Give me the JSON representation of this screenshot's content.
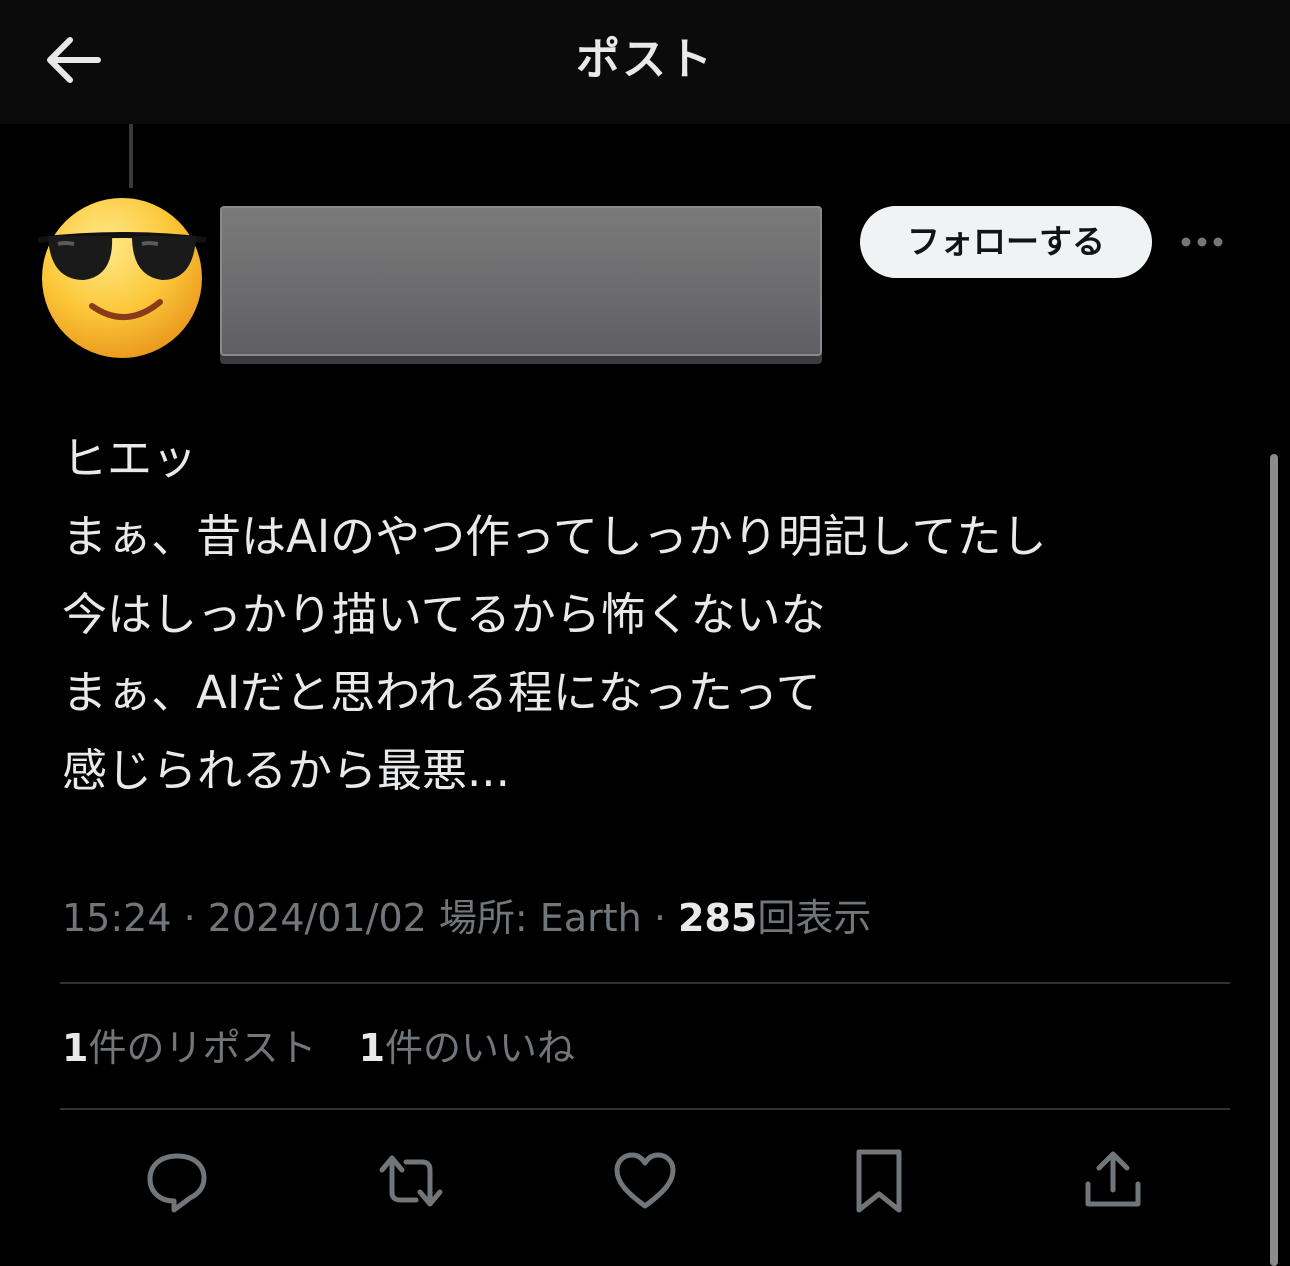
{
  "header": {
    "title": "ポスト",
    "back_icon": "arrow-left-icon"
  },
  "author": {
    "avatar_icon": "smiling-face-with-sunglasses-emoji",
    "follow_label": "フォローする",
    "more_icon": "more-horizontal-icon"
  },
  "post": {
    "lines": [
      "ヒエッ",
      "まぁ、昔はAIのやつ作ってしっかり明記してたし",
      "今はしっかり描いてるから怖くないな",
      "まぁ、AIだと思われる程になったって",
      "感じられるから最悪..."
    ]
  },
  "meta": {
    "time": "15:24",
    "separator": "·",
    "date": "2024/01/02",
    "location": "場所: Earth",
    "views_count": "285",
    "views_label": "回表示"
  },
  "stats": {
    "reposts_count": "1",
    "reposts_label": "件のリポスト",
    "likes_count": "1",
    "likes_label": "件のいいね"
  },
  "actions": [
    {
      "icon": "reply-icon"
    },
    {
      "icon": "repost-icon"
    },
    {
      "icon": "like-heart-icon"
    },
    {
      "icon": "bookmark-icon"
    },
    {
      "icon": "share-icon"
    }
  ],
  "colors": {
    "background": "#000000",
    "text_primary": "#e7e9ea",
    "text_secondary": "#71767b",
    "divider": "#2f3336",
    "follow_button_bg": "#eff3f4"
  }
}
